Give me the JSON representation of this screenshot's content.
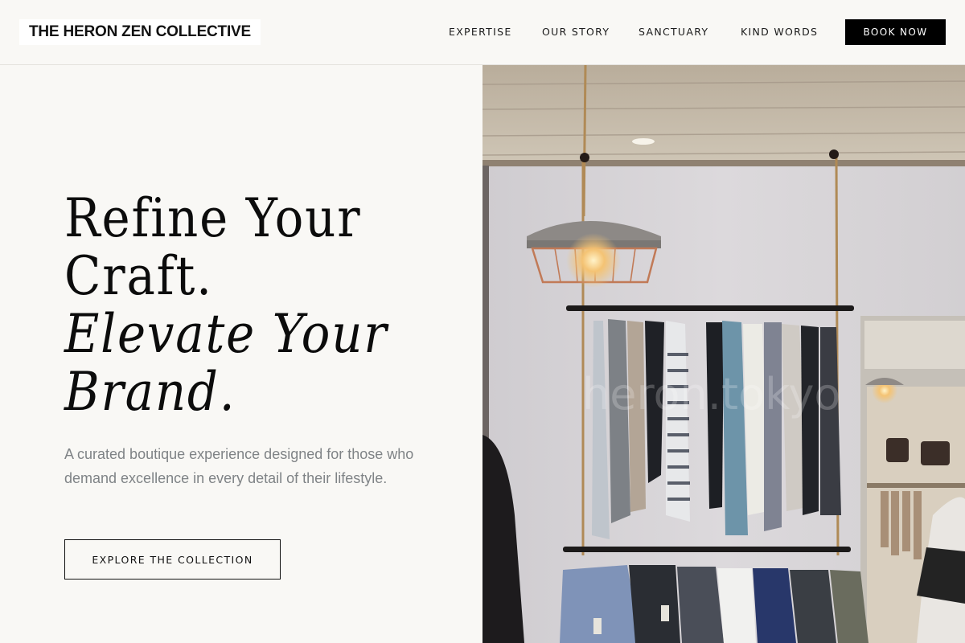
{
  "header": {
    "logo": "THE HERON ZEN COLLECTIVE",
    "nav": [
      "EXPERTISE",
      "OUR STORY",
      "SANCTUARY",
      "KIND WORDS"
    ],
    "cta": "BOOK NOW"
  },
  "hero": {
    "headline": [
      "Refine Your",
      "Craft.",
      "Elevate Your",
      "Brand."
    ],
    "subtext": "A curated boutique experience designed for those who demand excellence in every detail of their lifestyle.",
    "cta": "EXPLORE THE COLLECTION",
    "image_watermark": "heron.tokyo"
  },
  "colors": {
    "background": "#f9f8f5",
    "text": "#111111",
    "muted_text": "#7f8386",
    "button_bg": "#000000",
    "button_text": "#ffffff"
  }
}
